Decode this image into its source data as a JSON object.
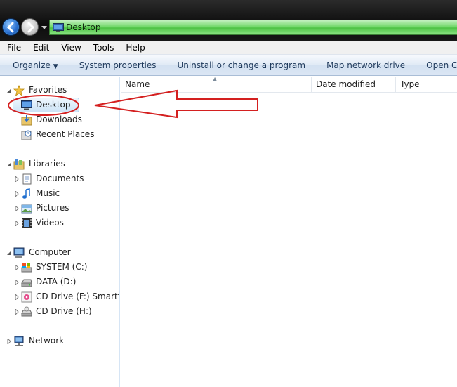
{
  "address": {
    "path": "Desktop"
  },
  "menu": [
    "File",
    "Edit",
    "View",
    "Tools",
    "Help"
  ],
  "commands": [
    {
      "label": "Organize",
      "caret": "▼"
    },
    {
      "label": "System properties"
    },
    {
      "label": "Uninstall or change a program"
    },
    {
      "label": "Map network drive"
    },
    {
      "label": "Open Control Panel"
    }
  ],
  "nav": {
    "favorites": {
      "label": "Favorites",
      "items": [
        "Desktop",
        "Downloads",
        "Recent Places"
      ]
    },
    "libraries": {
      "label": "Libraries",
      "items": [
        "Documents",
        "Music",
        "Pictures",
        "Videos"
      ]
    },
    "computer": {
      "label": "Computer",
      "items": [
        "SYSTEM (C:)",
        "DATA (D:)",
        "CD Drive (F:) Smartfren",
        "CD Drive (H:)"
      ]
    },
    "network": {
      "label": "Network"
    }
  },
  "columns": {
    "name": "Name",
    "date_modified": "Date modified",
    "type": "Type"
  },
  "colors": {
    "annotation": "#d42020",
    "selection": "#cde4f7",
    "address_bar": "#4ec245"
  }
}
